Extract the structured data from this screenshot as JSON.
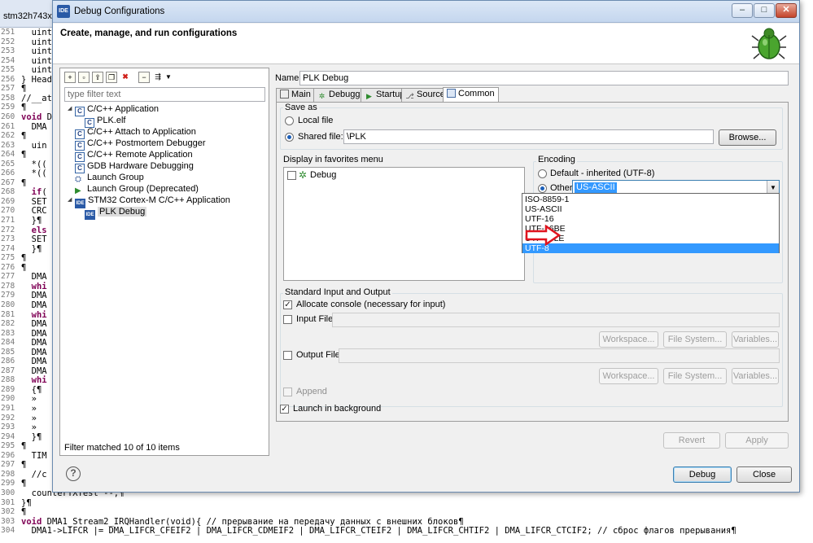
{
  "editor": {
    "tab_label": "stm32h743xx.h",
    "lines": [
      {
        "n": "251",
        "t": "  uint3"
      },
      {
        "n": "252",
        "t": "  uint3"
      },
      {
        "n": "253",
        "t": "  uint3"
      },
      {
        "n": "254",
        "t": "  uint3"
      },
      {
        "n": "255",
        "t": "  uint3"
      },
      {
        "n": "256",
        "t": "} Heade"
      },
      {
        "n": "257",
        "t": "¶"
      },
      {
        "n": "258",
        "t": "//__att"
      },
      {
        "n": "259",
        "t": "¶"
      },
      {
        "n": "260",
        "t": "void DM"
      },
      {
        "n": "261",
        "t": "  DMA"
      },
      {
        "n": "262",
        "t": "¶"
      },
      {
        "n": "263",
        "t": "  uin"
      },
      {
        "n": "264",
        "t": "¶"
      },
      {
        "n": "265",
        "t": "  *(("
      },
      {
        "n": "266",
        "t": "  *(("
      },
      {
        "n": "267",
        "t": "¶"
      },
      {
        "n": "268",
        "t": "  if("
      },
      {
        "n": "269",
        "t": "  SET"
      },
      {
        "n": "270",
        "t": "  CRC"
      },
      {
        "n": "271",
        "t": "  }¶"
      },
      {
        "n": "272",
        "t": "  els"
      },
      {
        "n": "273",
        "t": "  SET"
      },
      {
        "n": "274",
        "t": "  }¶"
      },
      {
        "n": "275",
        "t": "¶"
      },
      {
        "n": "276",
        "t": "¶"
      },
      {
        "n": "277",
        "t": "  DMA"
      },
      {
        "n": "278",
        "t": "  whi"
      },
      {
        "n": "279",
        "t": "  DMA"
      },
      {
        "n": "280",
        "t": "  DMA"
      },
      {
        "n": "281",
        "t": "  whi"
      },
      {
        "n": "282",
        "t": "  DMA"
      },
      {
        "n": "283",
        "t": "  DMA"
      },
      {
        "n": "284",
        "t": "  DMA"
      },
      {
        "n": "285",
        "t": "  DMA"
      },
      {
        "n": "286",
        "t": "  DMA"
      },
      {
        "n": "287",
        "t": "  DMA"
      },
      {
        "n": "288",
        "t": "  whi"
      },
      {
        "n": "289",
        "t": "  {¶"
      },
      {
        "n": "290",
        "t": "  »"
      },
      {
        "n": "291",
        "t": "  »"
      },
      {
        "n": "292",
        "t": "  »"
      },
      {
        "n": "293",
        "t": "  »"
      },
      {
        "n": "294",
        "t": "  }¶"
      },
      {
        "n": "295",
        "t": "¶"
      },
      {
        "n": "296",
        "t": "  TIM"
      },
      {
        "n": "297",
        "t": "¶"
      },
      {
        "n": "298",
        "t": "  //c"
      },
      {
        "n": "299",
        "t": "¶"
      },
      {
        "n": "300",
        "t": "  counterTXTest --;¶"
      },
      {
        "n": "301",
        "t": "}¶"
      },
      {
        "n": "302",
        "t": "¶"
      },
      {
        "n": "303",
        "t": "void DMA1_Stream2_IRQHandler(void){ // прерывание на передачу данных с внешних блоков¶"
      },
      {
        "n": "304",
        "t": "  DMA1->LIFCR |= DMA_LIFCR_CFEIF2 | DMA_LIFCR_CDMEIF2 | DMA_LIFCR_CTEIF2 | DMA_LIFCR_CHTIF2 | DMA_LIFCR_CTCIF2; // сброс флагов прерывания¶"
      }
    ]
  },
  "dialog": {
    "title": "Debug Configurations",
    "header_title": "Create, manage, and run configurations",
    "window_buttons": {
      "minimize": "–",
      "maximize": "□",
      "close": "✕"
    },
    "filter_placeholder": "type filter text",
    "tree": [
      {
        "label": "C/C++ Application",
        "level": 0,
        "expanded": true,
        "icon": "c-icon"
      },
      {
        "label": "PLK.elf",
        "level": 1,
        "icon": "c-icon"
      },
      {
        "label": "C/C++ Attach to Application",
        "level": 0,
        "icon": "c-icon"
      },
      {
        "label": "C/C++ Postmortem Debugger",
        "level": 0,
        "icon": "c-icon"
      },
      {
        "label": "C/C++ Remote Application",
        "level": 0,
        "icon": "c-icon"
      },
      {
        "label": "GDB Hardware Debugging",
        "level": 0,
        "icon": "c-icon"
      },
      {
        "label": "Launch Group",
        "level": 0,
        "icon": "launch-group-icon"
      },
      {
        "label": "Launch Group (Deprecated)",
        "level": 0,
        "icon": "launch-icon"
      },
      {
        "label": "STM32 Cortex-M C/C++ Application",
        "level": 0,
        "expanded": true,
        "icon": "ide-icon"
      },
      {
        "label": "PLK Debug",
        "level": 1,
        "icon": "ide-icon",
        "selected": true
      }
    ],
    "filter_status": "Filter matched 10 of 10 items",
    "name_label": "Name:",
    "name_value": "PLK Debug",
    "tabs": [
      "Main",
      "Debugger",
      "Startup",
      "Source",
      "Common"
    ],
    "active_tab": "Common",
    "save_as": {
      "group_label": "Save as",
      "local_file": "Local file",
      "shared_file": "Shared file:",
      "shared_path": "\\PLK",
      "browse": "Browse..."
    },
    "favorites": {
      "group_label": "Display in favorites menu",
      "items": [
        "Debug"
      ]
    },
    "encoding": {
      "group_label": "Encoding",
      "default": "Default - inherited (UTF-8)",
      "other": "Other",
      "other_value": "US-ASCII",
      "options": [
        "ISO-8859-1",
        "US-ASCII",
        "UTF-16",
        "UTF-16BE",
        "UTF-16LE",
        "UTF-8"
      ],
      "highlighted": "UTF-8"
    },
    "std_io": {
      "group_label": "Standard Input and Output",
      "allocate_console": "Allocate console (necessary for input)",
      "input_file": "Input File:",
      "output_file": "Output File:",
      "workspace": "Workspace...",
      "file_system": "File System...",
      "variables": "Variables...",
      "append": "Append"
    },
    "launch_background": "Launch in background",
    "revert": "Revert",
    "apply": "Apply",
    "debug": "Debug",
    "close": "Close",
    "help": "?"
  },
  "colors": {
    "accent": "#3399ff",
    "arrow": "#e0141e",
    "title_bar": "#c4d6ee"
  }
}
